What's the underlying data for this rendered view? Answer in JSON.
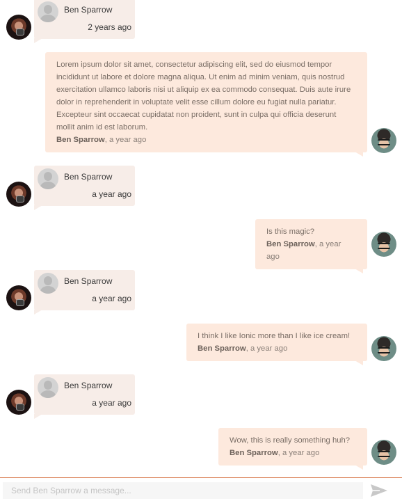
{
  "messages": [
    {
      "from": "them",
      "name": "Ben Sparrow",
      "time": "2 years ago"
    },
    {
      "from": "me",
      "text": "Lorem ipsum dolor sit amet, consectetur adipiscing elit, sed do eiusmod tempor incididunt ut labore et dolore magna aliqua. Ut enim ad minim veniam, quis nostrud exercitation ullamco laboris nisi ut aliquip ex ea commodo consequat. Duis aute irure dolor in reprehenderit in voluptate velit esse cillum dolore eu fugiat nulla pariatur. Excepteur sint occaecat cupidatat non proident, sunt in culpa qui officia deserunt mollit anim id est laborum.",
      "name": "Ben Sparrow",
      "time": ", a year ago"
    },
    {
      "from": "them",
      "name": "Ben Sparrow",
      "time": "a year ago"
    },
    {
      "from": "me",
      "text": "Is this magic?",
      "name": "Ben Sparrow",
      "time": ", a year ago"
    },
    {
      "from": "them",
      "name": "Ben Sparrow",
      "time": "a year ago"
    },
    {
      "from": "me",
      "text": "I think I like Ionic more than I like ice cream!",
      "name": "Ben Sparrow",
      "time": ", a year ago"
    },
    {
      "from": "them",
      "name": "Ben Sparrow",
      "time": "a year ago"
    },
    {
      "from": "me",
      "text": "Wow, this is really something huh?",
      "name": "Ben Sparrow",
      "time": ", a year ago"
    }
  ],
  "composer": {
    "placeholder": "Send Ben Sparrow a message..."
  },
  "icons": {
    "send": "send-icon",
    "contact_avatar": "contact-avatar",
    "user_avatar": "user-avatar",
    "placeholder_avatar": "person-placeholder-icon"
  },
  "colors": {
    "received_bubble": "#f7ede8",
    "sent_bubble": "#fde9dd",
    "footer_border": "#d9794e",
    "send_icon": "#c8c8c8"
  }
}
